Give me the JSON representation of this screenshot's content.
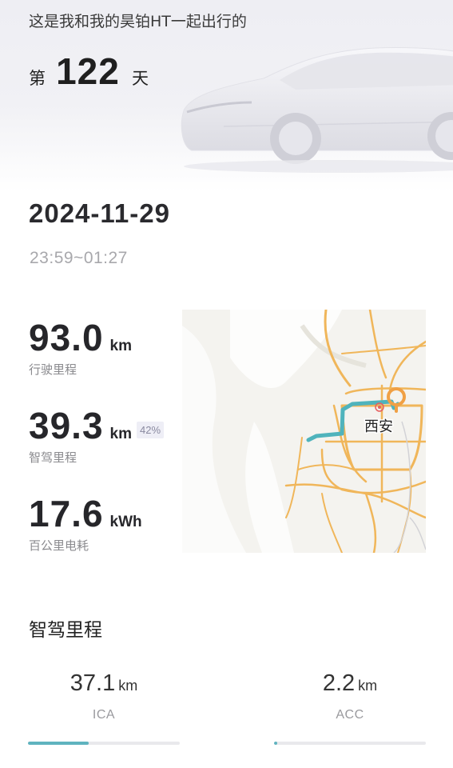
{
  "header": {
    "subtitle": "这是我和我的昊铂HT一起出行的",
    "day_prefix": "第",
    "day_count": "122",
    "day_suffix": "天"
  },
  "trip": {
    "date": "2024-11-29",
    "time_range": "23:59~01:27"
  },
  "stats": {
    "distance": {
      "value": "93.0",
      "unit": "km",
      "label": "行驶里程"
    },
    "smart_distance": {
      "value": "39.3",
      "unit": "km",
      "percent": "42%",
      "label": "智驾里程"
    },
    "consumption": {
      "value": "17.6",
      "unit": "kWh",
      "label": "百公里电耗"
    }
  },
  "map": {
    "city_label": "西安",
    "route_color": "#4fb3bc",
    "road_color": "#f0b65a",
    "marker_color": "#f0a045"
  },
  "adas": {
    "section_title": "智驾里程",
    "modes": [
      {
        "value": "37.1",
        "unit": "km",
        "name": "ICA",
        "fraction": 0.4
      },
      {
        "value": "2.2",
        "unit": "km",
        "name": "ACC",
        "fraction": 0.02
      }
    ],
    "accent_color": "#5fb3bf"
  }
}
